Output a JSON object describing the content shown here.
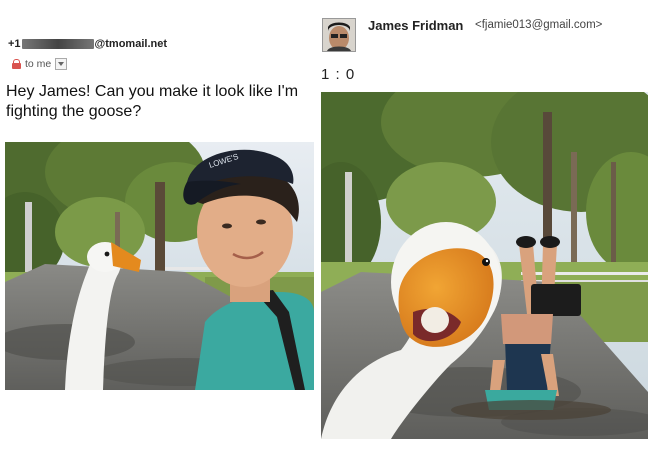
{
  "left_email": {
    "sender_prefix": "+1",
    "sender_suffix": "@tmomail.net",
    "to_label": "to me",
    "message": "Hey James! Can you make it look like I'm fighting the goose?",
    "photo_alt": "Young man in a cap taking a selfie next to a goose on a park path"
  },
  "right_reply": {
    "name": "James Fridman",
    "email": "<fjamie013@gmail.com>",
    "score": "1 : 0",
    "photo_alt": "Goose close-up with a man doing a headstand on the park path behind it"
  },
  "colors": {
    "lock": "#d9534f",
    "text": "#111111"
  }
}
